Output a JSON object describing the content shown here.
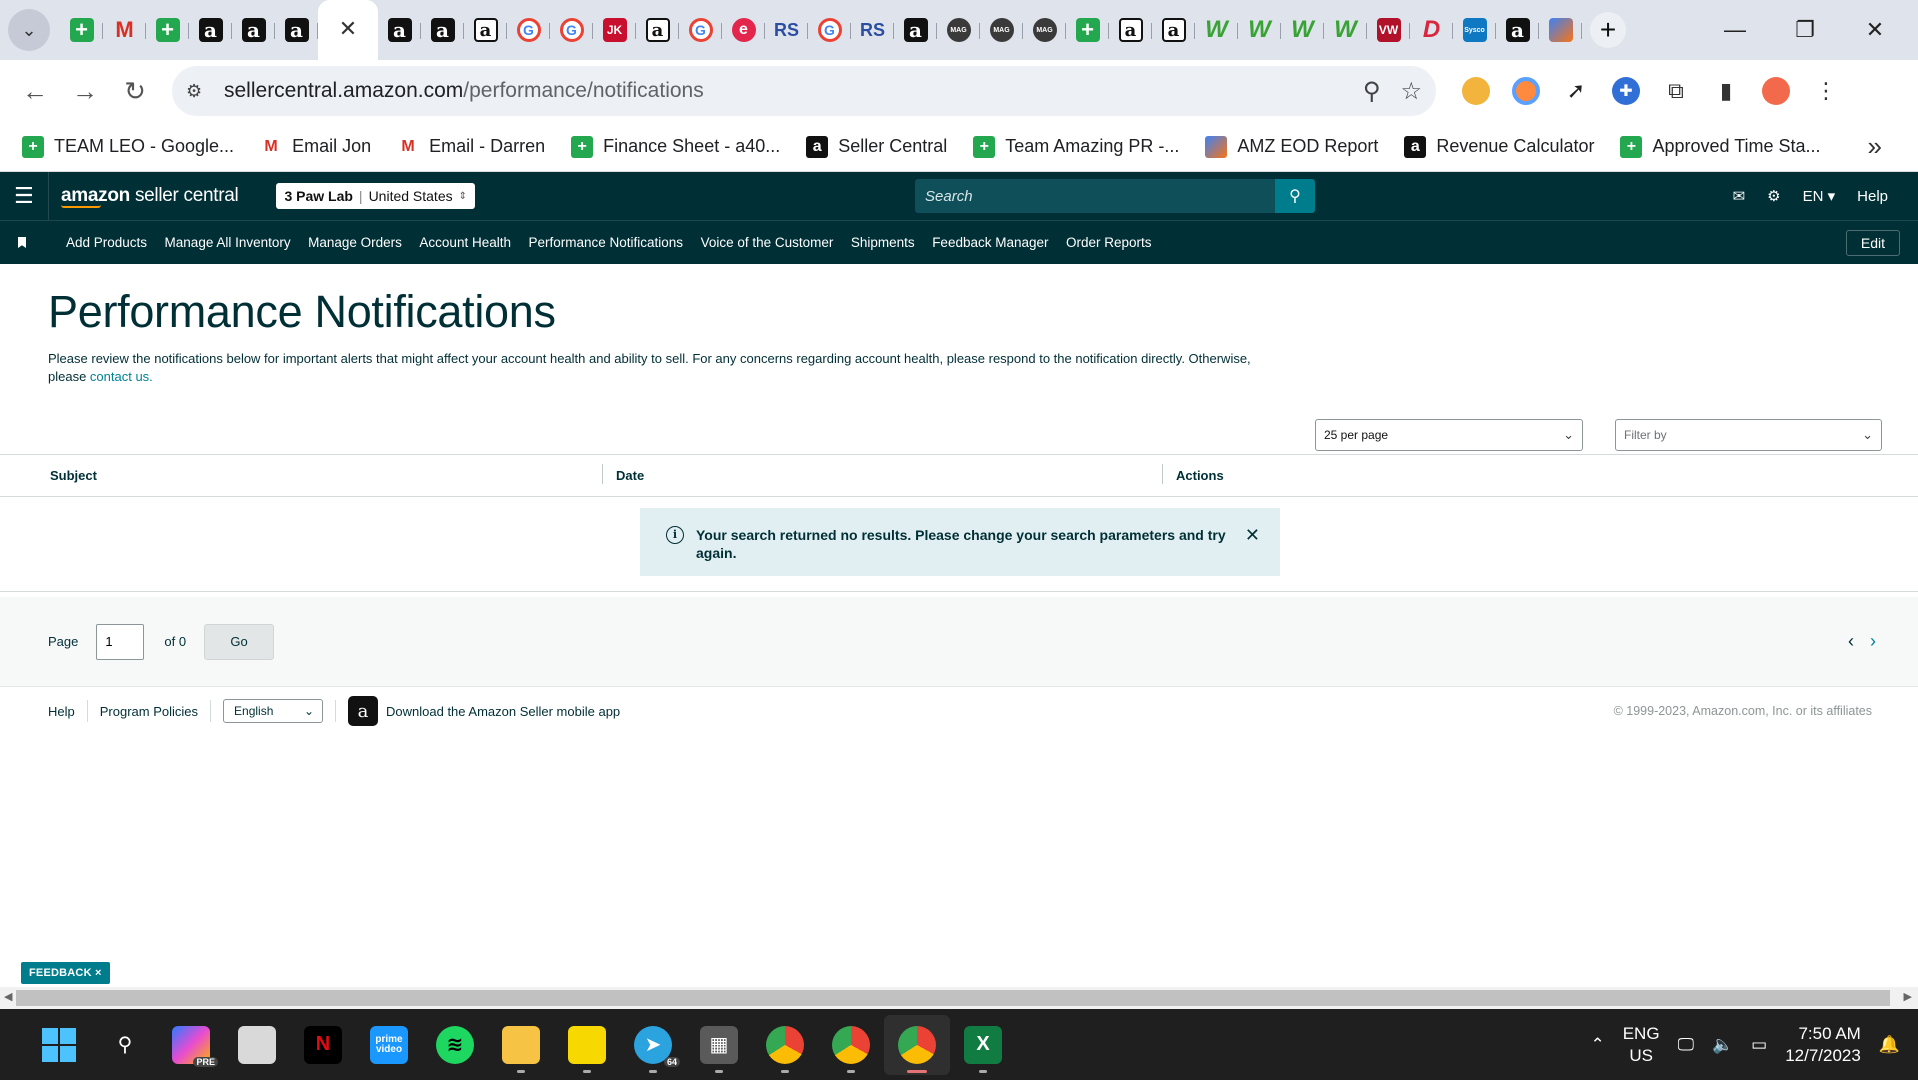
{
  "browser": {
    "tab_favicons": [
      "plus",
      "mail",
      "plus",
      "amz",
      "amz",
      "amz",
      "active",
      "amz",
      "amz",
      "amzw",
      "g",
      "g",
      "red",
      "amzw",
      "g",
      "cr",
      "rs",
      "g",
      "rs",
      "amz",
      "mag",
      "mag",
      "mag",
      "plus",
      "amzw",
      "amzw",
      "w",
      "w",
      "w",
      "w",
      "vw",
      "d",
      "sysco",
      "amz",
      "pen"
    ],
    "mag_label": "MAG",
    "sysco_label": "Sysco",
    "url_host": "sellercentral.amazon.com",
    "url_path": "/performance/notifications",
    "bookmarks": [
      {
        "label": "TEAM LEO - Google...",
        "icon": "plus"
      },
      {
        "label": "Email Jon",
        "icon": "mail"
      },
      {
        "label": "Email - Darren",
        "icon": "mail"
      },
      {
        "label": "Finance Sheet - a40...",
        "icon": "plus"
      },
      {
        "label": "Seller Central",
        "icon": "amz"
      },
      {
        "label": "Team Amazing PR -...",
        "icon": "plus"
      },
      {
        "label": "AMZ EOD Report",
        "icon": "pen"
      },
      {
        "label": "Revenue Calculator",
        "icon": "amz"
      },
      {
        "label": "Approved Time Sta...",
        "icon": "plus"
      }
    ]
  },
  "sc": {
    "logo_main": "amazon",
    "logo_sub": "seller central",
    "store_name": "3 Paw Lab",
    "store_region": "United States",
    "search_placeholder": "Search",
    "lang": "EN",
    "help": "Help",
    "nav": [
      "Add Products",
      "Manage All Inventory",
      "Manage Orders",
      "Account Health",
      "Performance Notifications",
      "Voice of the Customer",
      "Shipments",
      "Feedback Manager",
      "Order Reports"
    ],
    "edit": "Edit"
  },
  "page": {
    "title": "Performance Notifications",
    "intro_text": "Please review the notifications below for important alerts that might affect your account health and ability to sell. For any concerns regarding account health, please respond to the notification directly. Otherwise, please ",
    "contact_link": "contact us.",
    "per_page": "25 per page",
    "filter_placeholder": "Filter by",
    "columns": {
      "subject": "Subject",
      "date": "Date",
      "actions": "Actions"
    },
    "empty_message": "Your search returned no results. Please change your search parameters and try again.",
    "pager": {
      "page_label": "Page",
      "page_value": "1",
      "of_label": "of 0",
      "go": "Go"
    },
    "footer": {
      "help": "Help",
      "policies": "Program Policies",
      "language": "English",
      "app_download": "Download the Amazon Seller mobile app",
      "copyright": "© 1999-2023, Amazon.com, Inc. or its affiliates"
    },
    "feedback": "FEEDBACK ×"
  },
  "taskbar": {
    "apps": [
      "start",
      "search",
      "copilot",
      "files-white",
      "netflix",
      "prime-video",
      "spotify",
      "file-explorer",
      "sticky-notes",
      "telegram",
      "calculator",
      "chrome-1",
      "chrome-2",
      "chrome-3",
      "excel"
    ],
    "prime_label": "prime video",
    "telegram_badge": "64",
    "pre_badge": "PRE",
    "lang_line1": "ENG",
    "lang_line2": "US",
    "time": "7:50 AM",
    "date": "12/7/2023"
  }
}
